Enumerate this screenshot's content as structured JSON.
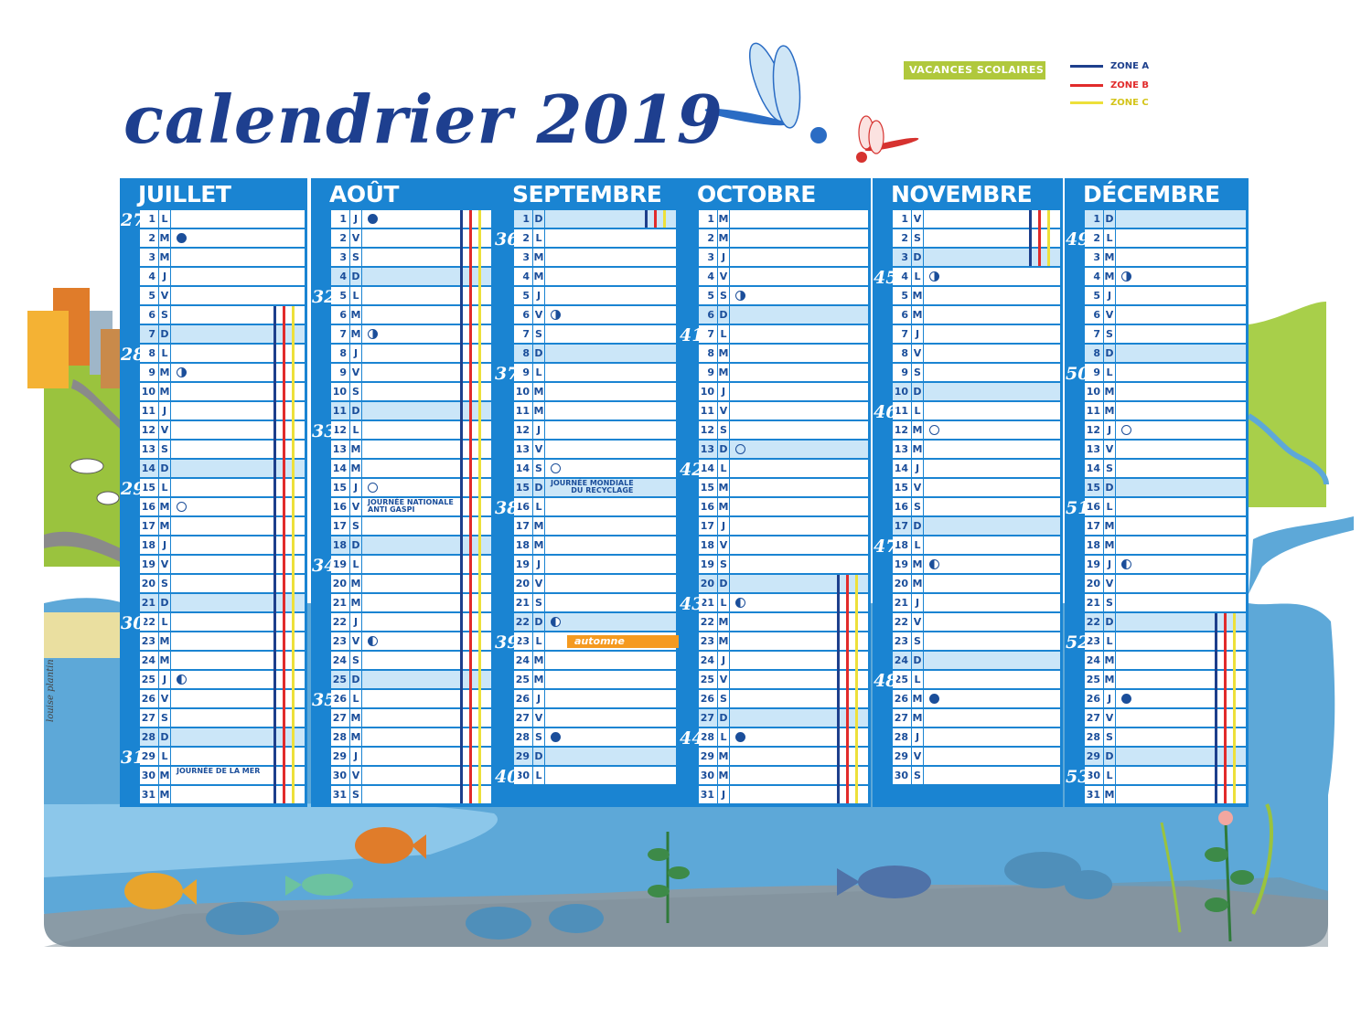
{
  "title": "calendrier 2019",
  "legend": {
    "holidays_label": "VACANCES SCOLAIRES",
    "zones": [
      {
        "label": "ZONE A",
        "color": "#1d3f8c"
      },
      {
        "label": "ZONE B",
        "color": "#e12b2b"
      },
      {
        "label": "ZONE C",
        "color": "#ede03a"
      }
    ]
  },
  "colors": {
    "month_blue": "#1a84d2",
    "weekend": "#cbe6f8",
    "text": "#1b4e9a",
    "accent": "#f59a20"
  },
  "signature": "louise plantin",
  "months": [
    {
      "name": "JUILLET",
      "days": [
        "L",
        "M",
        "M",
        "J",
        "V",
        "S",
        "D",
        "L",
        "M",
        "M",
        "J",
        "V",
        "S",
        "D",
        "L",
        "M",
        "M",
        "J",
        "V",
        "S",
        "D",
        "L",
        "M",
        "M",
        "J",
        "V",
        "S",
        "D",
        "L",
        "M",
        "M"
      ],
      "weeks": [
        {
          "n": "27",
          "day": 1
        },
        {
          "n": "28",
          "day": 8
        },
        {
          "n": "29",
          "day": 15
        },
        {
          "n": "30",
          "day": 22
        },
        {
          "n": "31",
          "day": 29
        }
      ],
      "moons": [
        {
          "day": 2,
          "phase": "new"
        },
        {
          "day": 9,
          "phase": "fq"
        },
        {
          "day": 16,
          "phase": "full"
        },
        {
          "day": 25,
          "phase": "lq"
        }
      ],
      "notes": [
        {
          "day": 30,
          "text": "JOURNÉE DE LA MER"
        }
      ],
      "holidays": [
        6,
        31
      ]
    },
    {
      "name": "AOÛT",
      "days": [
        "J",
        "V",
        "S",
        "D",
        "L",
        "M",
        "M",
        "J",
        "V",
        "S",
        "D",
        "L",
        "M",
        "M",
        "J",
        "V",
        "S",
        "D",
        "L",
        "M",
        "M",
        "J",
        "V",
        "S",
        "D",
        "L",
        "M",
        "M",
        "J",
        "V",
        "S"
      ],
      "weeks": [
        {
          "n": "32",
          "day": 5
        },
        {
          "n": "33",
          "day": 12
        },
        {
          "n": "34",
          "day": 19
        },
        {
          "n": "35",
          "day": 26
        }
      ],
      "moons": [
        {
          "day": 1,
          "phase": "new"
        },
        {
          "day": 7,
          "phase": "fq"
        },
        {
          "day": 15,
          "phase": "full"
        },
        {
          "day": 23,
          "phase": "lq"
        }
      ],
      "notes": [
        {
          "day": 16,
          "text": "JOURNÉE NATIONALE\nANTI GASPI"
        }
      ],
      "holidays": [
        1,
        31
      ]
    },
    {
      "name": "SEPTEMBRE",
      "days": [
        "D",
        "L",
        "M",
        "M",
        "J",
        "V",
        "S",
        "D",
        "L",
        "M",
        "M",
        "J",
        "V",
        "S",
        "D",
        "L",
        "M",
        "M",
        "J",
        "V",
        "S",
        "D",
        "L",
        "M",
        "M",
        "J",
        "V",
        "S",
        "D",
        "L"
      ],
      "weeks": [
        {
          "n": "36",
          "day": 2
        },
        {
          "n": "37",
          "day": 9
        },
        {
          "n": "38",
          "day": 16
        },
        {
          "n": "39",
          "day": 23
        },
        {
          "n": "40",
          "day": 30
        }
      ],
      "moons": [
        {
          "day": 6,
          "phase": "fq"
        },
        {
          "day": 14,
          "phase": "full"
        },
        {
          "day": 22,
          "phase": "lq"
        },
        {
          "day": 28,
          "phase": "new"
        }
      ],
      "notes": [
        {
          "day": 15,
          "text": "JOURNÉE MONDIALE\n        DU RECYCLAGE"
        }
      ],
      "season": {
        "day": 23,
        "label": "automne"
      },
      "holidays": [
        1,
        1
      ]
    },
    {
      "name": "OCTOBRE",
      "days": [
        "M",
        "M",
        "J",
        "V",
        "S",
        "D",
        "L",
        "M",
        "M",
        "J",
        "V",
        "S",
        "D",
        "L",
        "M",
        "M",
        "J",
        "V",
        "S",
        "D",
        "L",
        "M",
        "M",
        "J",
        "V",
        "S",
        "D",
        "L",
        "M",
        "M",
        "J"
      ],
      "weeks": [
        {
          "n": "41",
          "day": 7
        },
        {
          "n": "42",
          "day": 14
        },
        {
          "n": "43",
          "day": 21
        },
        {
          "n": "44",
          "day": 28
        }
      ],
      "moons": [
        {
          "day": 5,
          "phase": "fq"
        },
        {
          "day": 13,
          "phase": "full"
        },
        {
          "day": 21,
          "phase": "lq"
        },
        {
          "day": 28,
          "phase": "new"
        }
      ],
      "notes": [],
      "holidays": [
        20,
        31
      ]
    },
    {
      "name": "NOVEMBRE",
      "days": [
        "V",
        "S",
        "D",
        "L",
        "M",
        "M",
        "J",
        "V",
        "S",
        "D",
        "L",
        "M",
        "M",
        "J",
        "V",
        "S",
        "D",
        "L",
        "M",
        "M",
        "J",
        "V",
        "S",
        "D",
        "L",
        "M",
        "M",
        "J",
        "V",
        "S"
      ],
      "weeks": [
        {
          "n": "45",
          "day": 4
        },
        {
          "n": "46",
          "day": 11
        },
        {
          "n": "47",
          "day": 18
        },
        {
          "n": "48",
          "day": 25
        }
      ],
      "moons": [
        {
          "day": 4,
          "phase": "fq"
        },
        {
          "day": 12,
          "phase": "full"
        },
        {
          "day": 19,
          "phase": "lq"
        },
        {
          "day": 26,
          "phase": "new"
        }
      ],
      "notes": [],
      "holidays": [
        1,
        3
      ]
    },
    {
      "name": "DÉCEMBRE",
      "days": [
        "D",
        "L",
        "M",
        "M",
        "J",
        "V",
        "S",
        "D",
        "L",
        "M",
        "M",
        "J",
        "V",
        "S",
        "D",
        "L",
        "M",
        "M",
        "J",
        "V",
        "S",
        "D",
        "L",
        "M",
        "M",
        "J",
        "V",
        "S",
        "D",
        "L",
        "M"
      ],
      "weeks": [
        {
          "n": "49",
          "day": 2
        },
        {
          "n": "50",
          "day": 9
        },
        {
          "n": "51",
          "day": 16
        },
        {
          "n": "52",
          "day": 23
        },
        {
          "n": "53",
          "day": 30
        }
      ],
      "moons": [
        {
          "day": 4,
          "phase": "fq"
        },
        {
          "day": 12,
          "phase": "full"
        },
        {
          "day": 19,
          "phase": "lq"
        },
        {
          "day": 26,
          "phase": "new"
        }
      ],
      "notes": [],
      "holidays": [
        22,
        31
      ]
    }
  ]
}
